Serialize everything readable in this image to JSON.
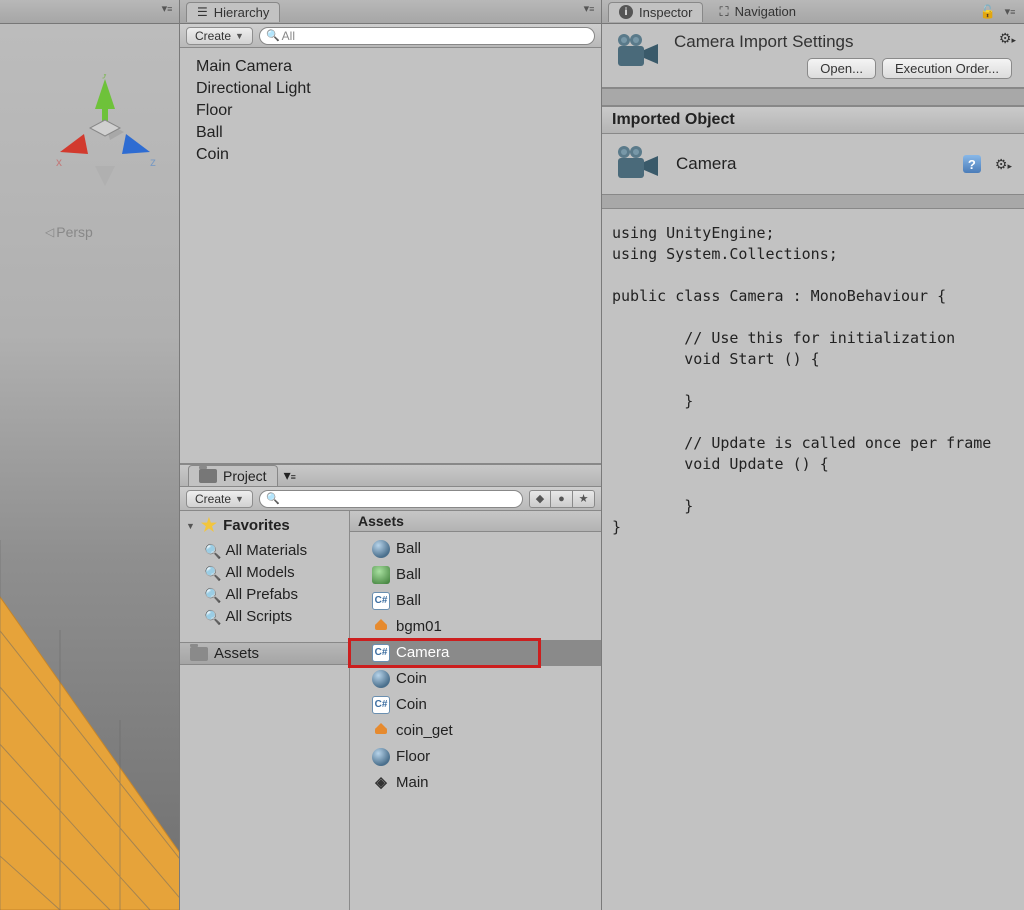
{
  "scene": {
    "persp_label": "Persp",
    "axes": {
      "x": "x",
      "y": "y",
      "z": "z"
    }
  },
  "hierarchy": {
    "tab_label": "Hierarchy",
    "create_label": "Create",
    "search_placeholder": "All",
    "items": [
      "Main Camera",
      "Directional Light",
      "Floor",
      "Ball",
      "Coin"
    ]
  },
  "project": {
    "tab_label": "Project",
    "create_label": "Create",
    "favorites_label": "Favorites",
    "favorites": [
      "All Materials",
      "All Models",
      "All Prefabs",
      "All Scripts"
    ],
    "assets_folder": "Assets",
    "assets_header": "Assets",
    "assets": [
      {
        "name": "Ball",
        "type": "sphere"
      },
      {
        "name": "Ball",
        "type": "prefab"
      },
      {
        "name": "Ball",
        "type": "cs"
      },
      {
        "name": "bgm01",
        "type": "audio"
      },
      {
        "name": "Camera",
        "type": "cs",
        "selected": true,
        "highlight": true
      },
      {
        "name": "Coin",
        "type": "sphere"
      },
      {
        "name": "Coin",
        "type": "cs"
      },
      {
        "name": "coin_get",
        "type": "audio"
      },
      {
        "name": "Floor",
        "type": "sphere"
      },
      {
        "name": "Main",
        "type": "unity"
      }
    ]
  },
  "inspector": {
    "tab_label": "Inspector",
    "nav_tab_label": "Navigation",
    "title": "Camera Import Settings",
    "open_btn": "Open...",
    "exec_btn": "Execution Order...",
    "imported_object": "Imported Object",
    "object_name": "Camera",
    "code": "using UnityEngine;\nusing System.Collections;\n\npublic class Camera : MonoBehaviour {\n\n        // Use this for initialization\n        void Start () {\n\n        }\n\n        // Update is called once per frame\n        void Update () {\n\n        }\n}"
  }
}
